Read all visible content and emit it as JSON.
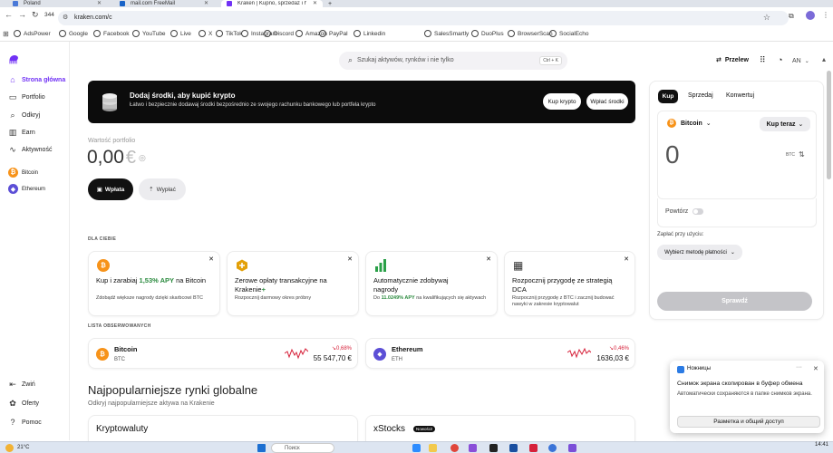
{
  "browser": {
    "tabs": [
      {
        "label": "Poland",
        "color": "#4a79d8"
      },
      {
        "label": "mail.com FreeMail",
        "color": "#1a64c8"
      },
      {
        "label": "Kraken | Kupno, sprzedaż i handel",
        "color": "#7132f5"
      }
    ],
    "new_tab": "+",
    "tab_count": "344",
    "url": "kraken.com/c",
    "bookmarks": [
      "AdsPower",
      "Google",
      "Facebook",
      "YouTube",
      "Live",
      "X",
      "TikTok",
      "Instagram",
      "Discord",
      "Amazon",
      "PayPal",
      "Linkedin",
      "SalesSmartly",
      "DuoPlus",
      "BrowserScan",
      "SocialEcho"
    ]
  },
  "sidebar": {
    "items": [
      {
        "label": "Strona główna",
        "icon": "home-icon"
      },
      {
        "label": "Portfolio",
        "icon": "portfolio-icon"
      },
      {
        "label": "Odkryj",
        "icon": "search-icon"
      },
      {
        "label": "Earn",
        "icon": "earn-icon"
      },
      {
        "label": "Aktywność",
        "icon": "activity-icon"
      }
    ],
    "coins": [
      {
        "label": "Bitcoin",
        "symbol": "₿",
        "color": "#f7931a"
      },
      {
        "label": "Ethereum",
        "symbol": "◆",
        "color": "#5c4fd6"
      }
    ],
    "bottom": [
      "Zwiń",
      "Oferty",
      "Pomoc"
    ]
  },
  "header": {
    "search_placeholder": "Szukaj aktywów, rynków i nie tylko",
    "search_shortcut": "Ctrl + K",
    "transfer": "Przelew",
    "avatar": "AN"
  },
  "banner": {
    "title": "Dodaj środki, aby kupić krypto",
    "subtitle": "Łatwo i bezpiecznie dodawaj środki bezpośrednio ze swojego rachunku bankowego lub portfela krypto",
    "buy": "Kup krypto",
    "deposit": "Wpłać środki"
  },
  "portfolio": {
    "label": "Wartość portfolio",
    "value": "0,00",
    "currency": "€",
    "deposit": "Wpłata",
    "withdraw": "Wypłać"
  },
  "for_you": {
    "heading": "DLA CIEBIE",
    "cards": [
      {
        "title_a": "Kup i zarabiaj ",
        "highlight": "1,53% APY",
        "title_b": " na Bitcoin",
        "desc": "Zdobądź większe nagrody dzięki skarbcowi BTC"
      },
      {
        "title_a": "Zerowe opłaty transakcyjne na Krakenie",
        "highlight": "+",
        "title_b": "",
        "desc": "Rozpocznij darmowy okres próbny"
      },
      {
        "title_a": "Automatycznie zdobywaj nagrody",
        "highlight": "",
        "title_b": "",
        "desc_a": "Do ",
        "desc_hl": "11.0249% APY",
        "desc_b": " na kwalifikujących się aktywach"
      },
      {
        "title_a": "Rozpocznij przygodę ze strategią DCA",
        "highlight": "",
        "title_b": "",
        "desc": "Rozpocznij przygodę z BTC i zacznij budować nawyki w zakresie kryptowalut"
      }
    ]
  },
  "watchlist": {
    "heading": "LISTA OBSERWOWANYCH",
    "items": [
      {
        "name": "Bitcoin",
        "ticker": "BTC",
        "change": "↘0,68%",
        "price": "55 547,70 €",
        "color": "#f7931a",
        "symbol": "₿"
      },
      {
        "name": "Ethereum",
        "ticker": "ETH",
        "change": "↘0,46%",
        "price": "1636,03 €",
        "color": "#5c4fd6",
        "symbol": "◆"
      }
    ]
  },
  "markets": {
    "title": "Najpopularniejsze rynki globalne",
    "subtitle": "Odkryj najpopularniejsze aktywa na Krakenie",
    "col1": "Kryptowaluty",
    "col2": "xStocks",
    "badge": "Nowości!"
  },
  "trade": {
    "tabs": [
      "Kup",
      "Sprzedaj",
      "Konwertuj"
    ],
    "asset": "Bitcoin",
    "mode": "Kup teraz",
    "amount": "0",
    "unit": "BTC",
    "repeat": "Powtórz",
    "pay_with": "Zapłać przy użyciu:",
    "method": "Wybierz metodę płatności",
    "check": "Sprawdź"
  },
  "toast": {
    "app": "Ножницы",
    "title": "Снимок экрана скопирован в буфер обмена",
    "body": "Автоматически сохраняются в папке снимков экрана.",
    "action": "Разметка и общий доступ"
  },
  "taskbar": {
    "weather": "21°C",
    "search": "Поиск",
    "time": "14:41"
  }
}
